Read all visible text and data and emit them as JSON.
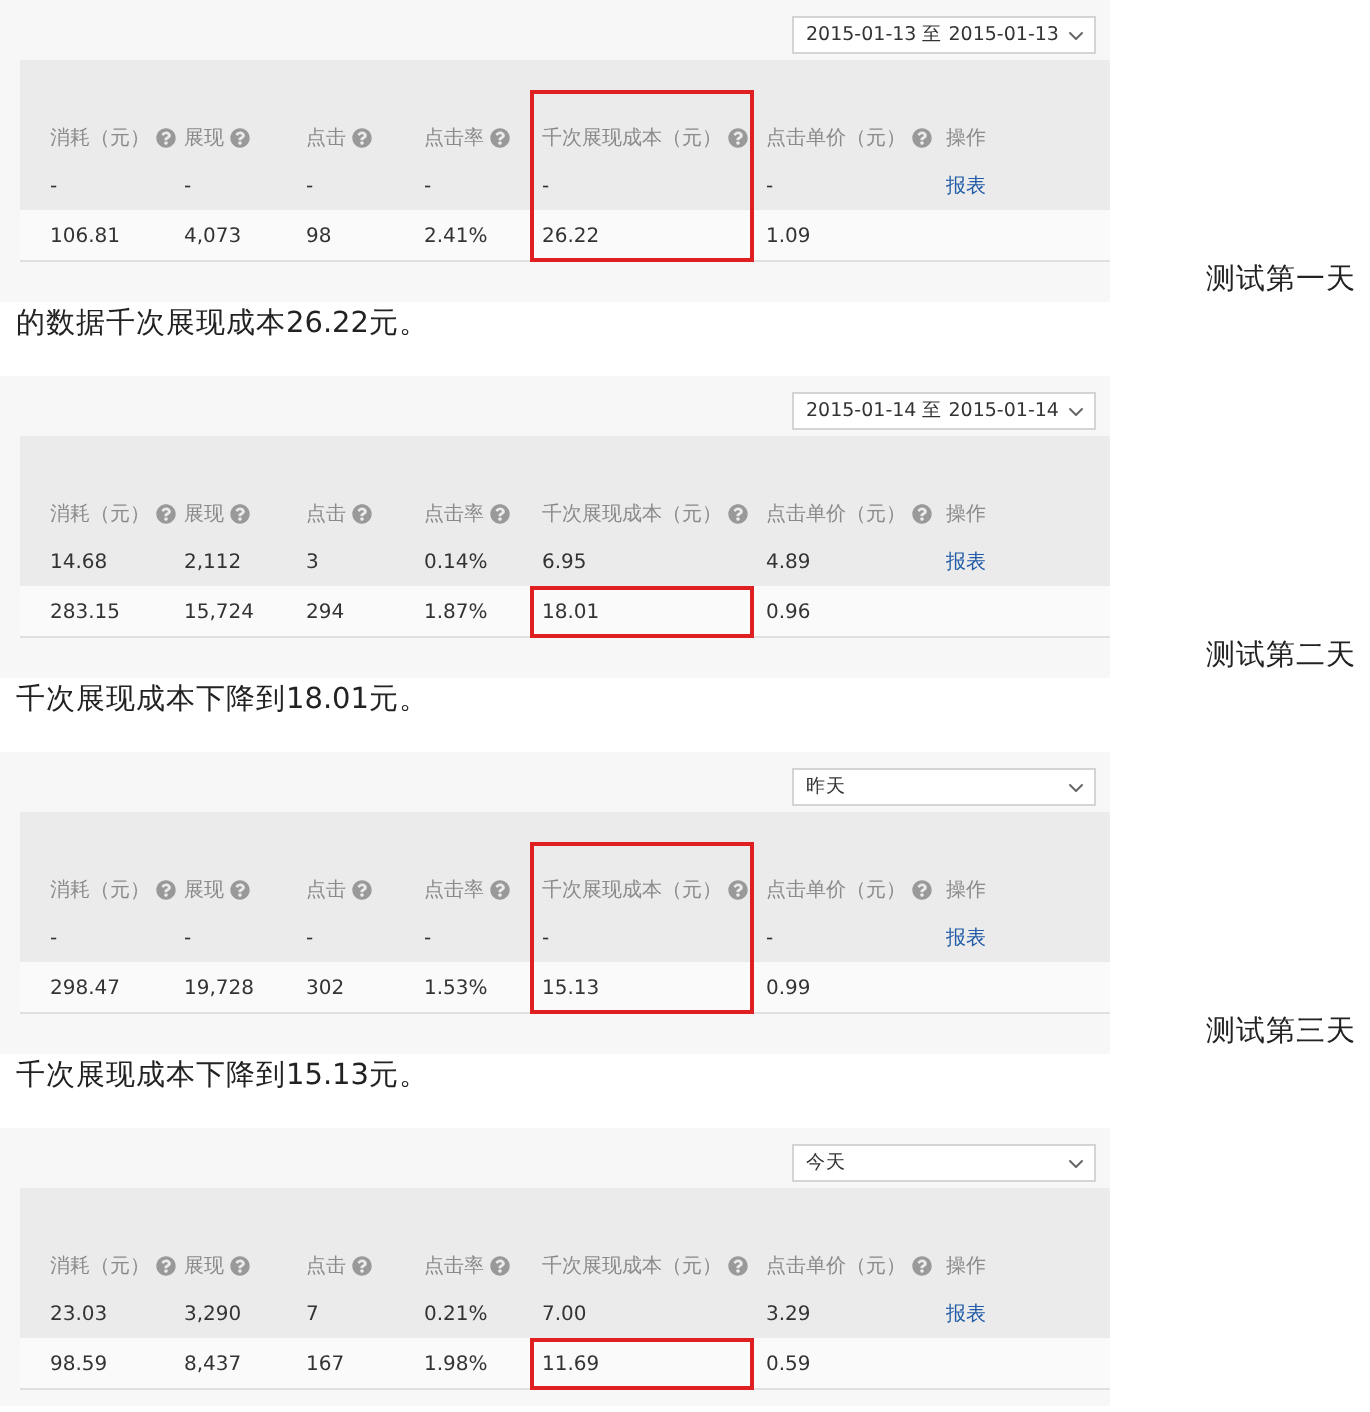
{
  "blocks": [
    {
      "date_select": "2015-01-13 至 2015-01-13",
      "table": {
        "highlight_header": true,
        "columns": [
          {
            "label": "消耗（元）",
            "help": true,
            "highlighted": false
          },
          {
            "label": "展现",
            "help": true,
            "highlighted": false
          },
          {
            "label": "点击",
            "help": true,
            "highlighted": false
          },
          {
            "label": "点击率",
            "help": true,
            "highlighted": false
          },
          {
            "label": "千次展现成本（元）",
            "help": true,
            "highlighted": true
          },
          {
            "label": "点击单价（元）",
            "help": true,
            "highlighted": false
          },
          {
            "label": "操作"
          }
        ],
        "rows": [
          {
            "cells": [
              "-",
              "-",
              "-",
              "-",
              "-",
              "-"
            ],
            "action": "报表"
          },
          {
            "cells": [
              "106.81",
              "4,073",
              "98",
              "2.41%",
              "26.22",
              "1.09"
            ]
          }
        ]
      },
      "caption": "测试第一天的数据千次展现成本26.22元。"
    },
    {
      "date_select": "2015-01-14 至 2015-01-14",
      "table": {
        "highlight_header": false,
        "columns": [
          {
            "label": "消耗（元）",
            "help": true,
            "highlighted": false
          },
          {
            "label": "展现",
            "help": true,
            "highlighted": false
          },
          {
            "label": "点击",
            "help": true,
            "highlighted": false
          },
          {
            "label": "点击率",
            "help": true,
            "highlighted": false
          },
          {
            "label": "千次展现成本（元）",
            "help": true,
            "highlighted": true
          },
          {
            "label": "点击单价（元）",
            "help": true,
            "highlighted": false
          },
          {
            "label": "操作"
          }
        ],
        "rows": [
          {
            "cells": [
              "14.68",
              "2,112",
              "3",
              "0.14%",
              "6.95",
              "4.89"
            ],
            "action": "报表"
          },
          {
            "cells": [
              "283.15",
              "15,724",
              "294",
              "1.87%",
              "18.01",
              "0.96"
            ]
          }
        ]
      },
      "caption": "测试第二天千次展现成本下降到18.01元。"
    },
    {
      "date_select": "昨天",
      "table": {
        "highlight_header": true,
        "columns": [
          {
            "label": "消耗（元）",
            "help": true,
            "highlighted": false
          },
          {
            "label": "展现",
            "help": true,
            "highlighted": false
          },
          {
            "label": "点击",
            "help": true,
            "highlighted": false
          },
          {
            "label": "点击率",
            "help": true,
            "highlighted": false
          },
          {
            "label": "千次展现成本（元）",
            "help": true,
            "highlighted": true
          },
          {
            "label": "点击单价（元）",
            "help": true,
            "highlighted": false
          },
          {
            "label": "操作"
          }
        ],
        "rows": [
          {
            "cells": [
              "-",
              "-",
              "-",
              "-",
              "-",
              "-"
            ],
            "action": "报表"
          },
          {
            "cells": [
              "298.47",
              "19,728",
              "302",
              "1.53%",
              "15.13",
              "0.99"
            ]
          }
        ]
      },
      "caption": "测试第三天千次展现成本下降到15.13元。"
    },
    {
      "date_select": "今天",
      "table": {
        "highlight_header": false,
        "columns": [
          {
            "label": "消耗（元）",
            "help": true,
            "highlighted": false
          },
          {
            "label": "展现",
            "help": true,
            "highlighted": false
          },
          {
            "label": "点击",
            "help": true,
            "highlighted": false
          },
          {
            "label": "点击率",
            "help": true,
            "highlighted": false
          },
          {
            "label": "千次展现成本（元）",
            "help": true,
            "highlighted": true
          },
          {
            "label": "点击单价（元）",
            "help": true,
            "highlighted": false
          },
          {
            "label": "操作"
          }
        ],
        "rows": [
          {
            "cells": [
              "23.03",
              "3,290",
              "7",
              "0.21%",
              "7.00",
              "3.29"
            ],
            "action": "报表"
          },
          {
            "cells": [
              "98.59",
              "8,437",
              "167",
              "1.98%",
              "11.69",
              "0.59"
            ]
          }
        ]
      }
    }
  ]
}
